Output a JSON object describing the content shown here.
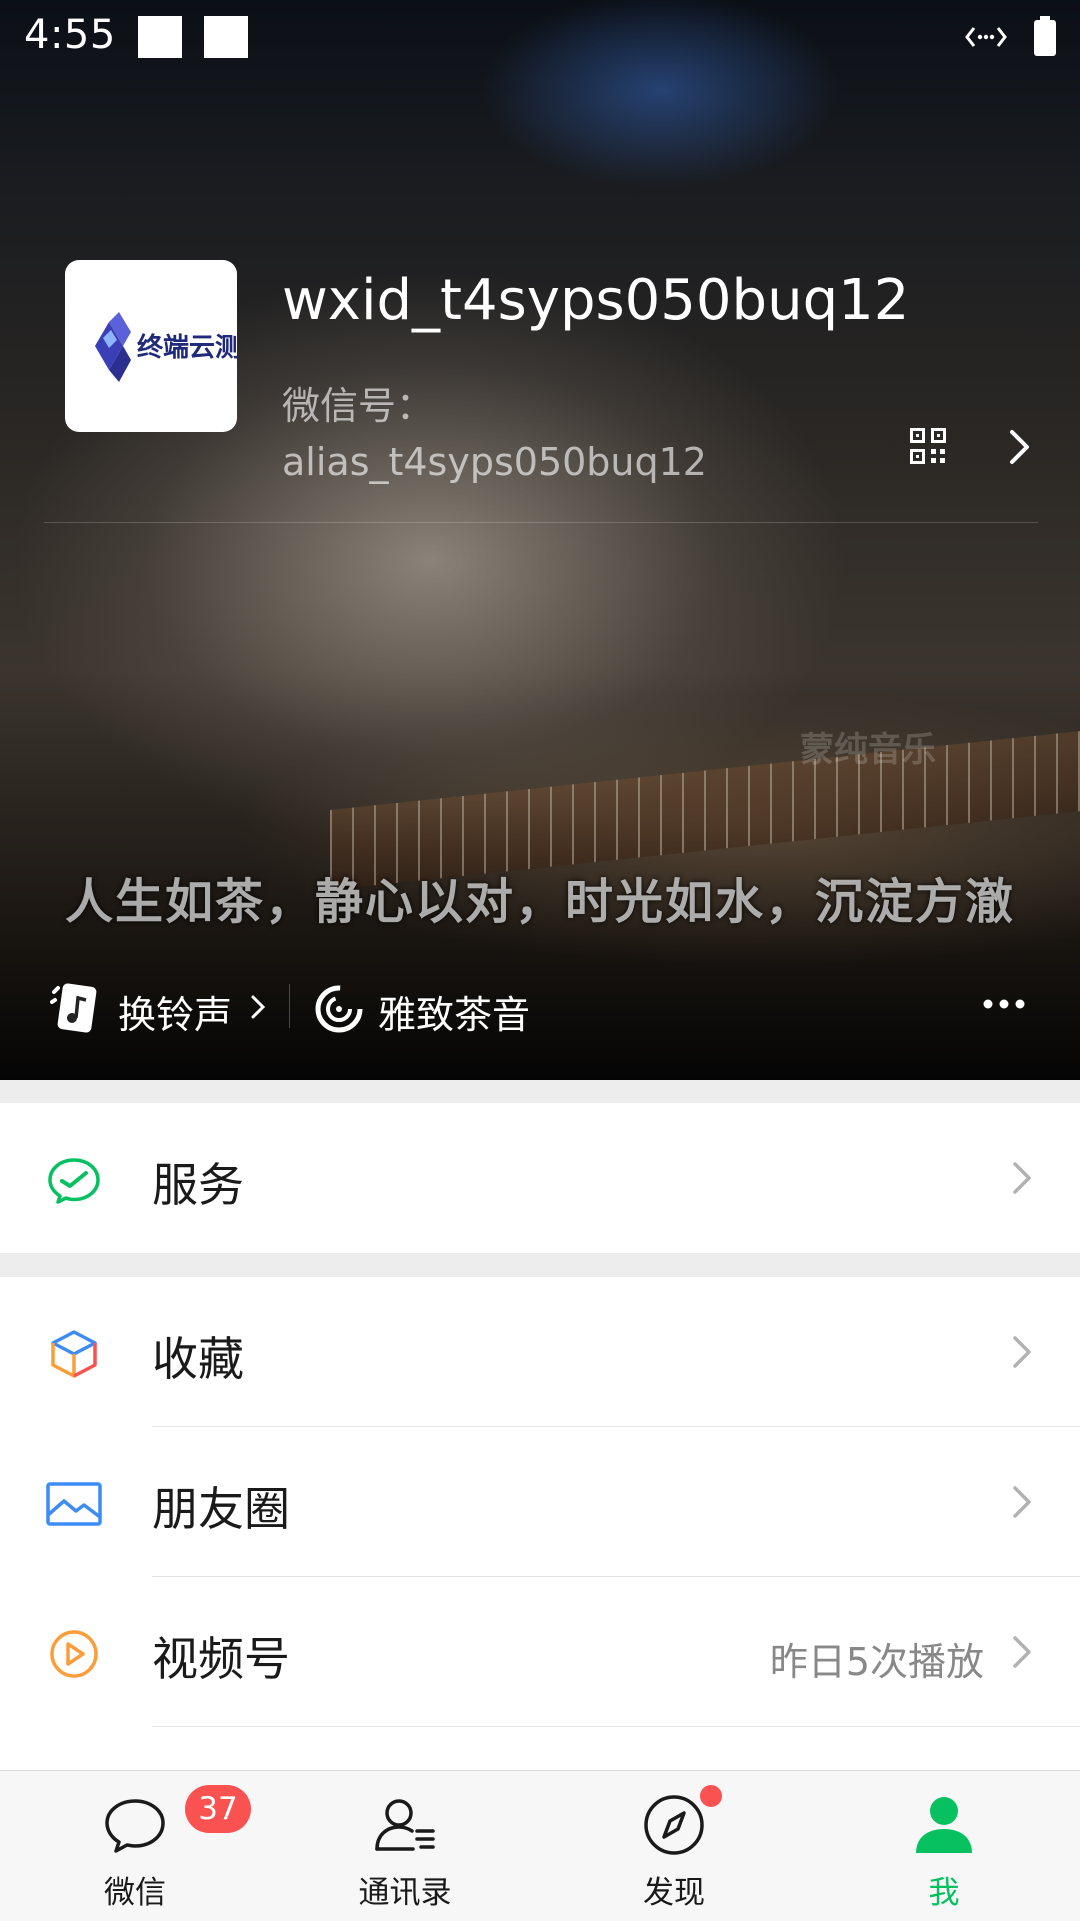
{
  "status_bar": {
    "time": "4:55"
  },
  "profile": {
    "avatar_text": "终端云测",
    "nickname": "wxid_t4syps050buq12",
    "id_label": "微信号：",
    "id_value": "alias_t4syps050buq12"
  },
  "banner": {
    "lyric": "人生如茶，静心以对，时光如水，沉淀方澈",
    "watermark": "蒙纯音乐"
  },
  "ringtone": {
    "label": "换铃声",
    "music_title": "雅致茶音"
  },
  "menu": {
    "services": {
      "label": "服务",
      "icon": "wechat-pay-icon"
    },
    "favorites": {
      "label": "收藏",
      "icon": "cube-icon"
    },
    "moments": {
      "label": "朋友圈",
      "icon": "image-icon"
    },
    "channels": {
      "label": "视频号",
      "subtext": "昨日5次播放",
      "icon": "play-circle-icon"
    }
  },
  "tabs": [
    {
      "label": "微信",
      "badge": "37",
      "icon": "chat-bubble-icon"
    },
    {
      "label": "通讯录",
      "icon": "contacts-icon"
    },
    {
      "label": "发现",
      "icon": "compass-icon"
    },
    {
      "label": "我",
      "icon": "person-icon",
      "active": true
    }
  ],
  "colors": {
    "accent": "#07c160",
    "badge": "#fa5151"
  }
}
